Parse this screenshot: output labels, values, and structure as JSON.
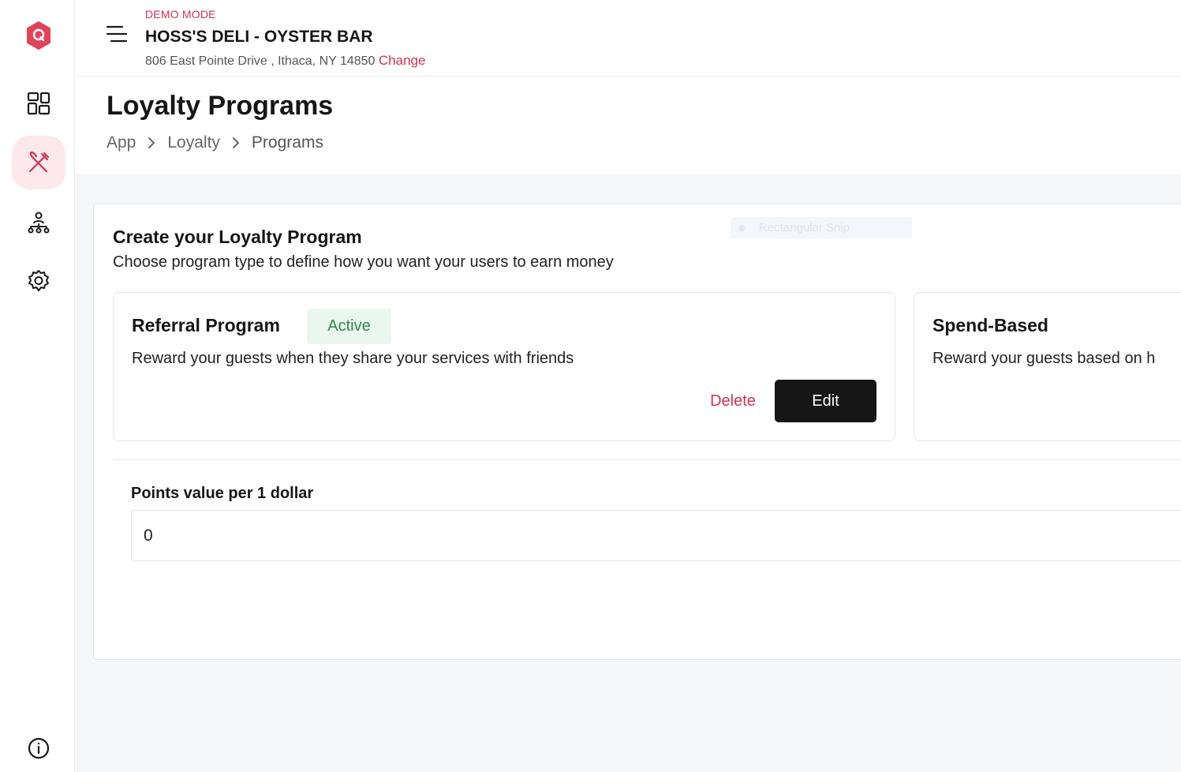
{
  "header": {
    "demo_mode": "DEMO MODE",
    "store_name": "HOSS'S DELI - OYSTER BAR",
    "address": "806 East Pointe Drive , Ithaca, NY 14850",
    "change_label": "Change"
  },
  "page": {
    "title": "Loyalty Programs",
    "breadcrumb": [
      "App",
      "Loyalty",
      "Programs"
    ]
  },
  "overlay": {
    "snip_text": "Rectangular Snip"
  },
  "panel": {
    "title": "Create your Loyalty Program",
    "subtitle": "Choose program type to define how you want your users to earn money"
  },
  "programs": [
    {
      "title": "Referral Program",
      "status": "Active",
      "description": "Reward your guests when they share your services with friends",
      "delete_label": "Delete",
      "edit_label": "Edit"
    },
    {
      "title": "Spend-Based",
      "description": "Reward your guests based on h"
    }
  ],
  "points": {
    "label": "Points value per 1 dollar",
    "value": "0"
  },
  "colors": {
    "accent": "#d0334f",
    "active_bg": "#fde8ec",
    "badge_bg": "#eaf7ee",
    "badge_text": "#2e8c4a",
    "button_dark": "#161616"
  },
  "icons": {
    "logo": "q-hexagon-logo",
    "nav": [
      "dashboard-icon",
      "dining-icon",
      "organization-icon",
      "settings-icon",
      "info-icon"
    ],
    "menu": "hamburger-menu-icon",
    "breadcrumb_sep": "chevron-right-icon"
  }
}
